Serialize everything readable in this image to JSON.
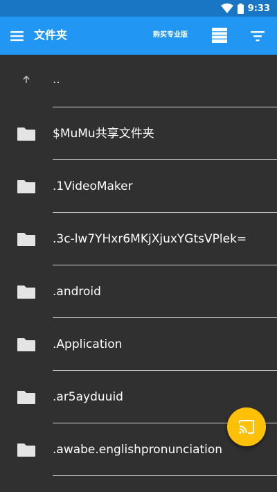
{
  "status_bar": {
    "time": "9:33",
    "icons": [
      "wifi-icon",
      "battery-icon"
    ],
    "color": "#1976c4"
  },
  "app_bar": {
    "menu_icon": "hamburger-menu-icon",
    "title": "文件夹",
    "pro_label": "购买专业版",
    "view_icon": "list-view-icon",
    "filter_icon": "filter-sort-icon",
    "color": "#2196f3"
  },
  "file_list": {
    "items": [
      {
        "name": "..",
        "icon": "arrow-up-icon"
      },
      {
        "name": "$MuMu共享文件夹",
        "icon": "folder-icon"
      },
      {
        "name": ".1VideoMaker",
        "icon": "folder-icon"
      },
      {
        "name": ".3c-lw7YHxr6MKjXjuxYGtsVPlek=",
        "icon": "folder-icon"
      },
      {
        "name": ".android",
        "icon": "folder-icon"
      },
      {
        "name": ".Application",
        "icon": "folder-icon"
      },
      {
        "name": ".ar5ayduuid",
        "icon": "folder-icon"
      },
      {
        "name": ".awabe.englishpronunciation",
        "icon": "folder-icon"
      }
    ]
  },
  "fab": {
    "icon": "cast-icon",
    "color": "#ffc107"
  },
  "colors": {
    "background": "#303030",
    "divider": "#d6d6d6",
    "text": "#ffffff"
  }
}
